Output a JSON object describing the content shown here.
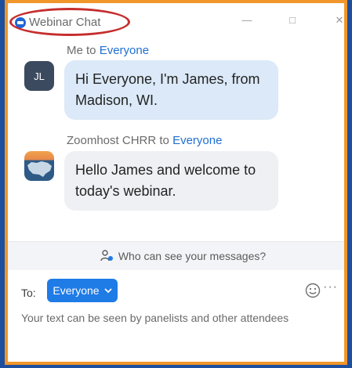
{
  "window": {
    "title": "Webinar Chat",
    "minimize_symbol": "—",
    "maximize_symbol": "□",
    "close_symbol": "✕"
  },
  "messages": [
    {
      "sender": "Me",
      "to_word": "to",
      "recipient": "Everyone",
      "avatar_initials": "JL",
      "text": "Hi Everyone, I'm James, from Madison, WI."
    },
    {
      "sender": "Zoomhost CHRR",
      "to_word": "to",
      "recipient": "Everyone",
      "avatar_icon": "map-logo-icon",
      "text": "Hello James and welcome to today's webinar."
    }
  ],
  "privacy": {
    "label": "Who can see your messages?"
  },
  "compose": {
    "to_label": "To:",
    "recipient_button": "Everyone",
    "placeholder": "Your text can be seen by panelists and other attendees",
    "more_symbol": "···"
  },
  "colors": {
    "accent": "#1f7be6",
    "frame": "#f0962b",
    "highlight_oval": "#c62d2d",
    "background": "#1d4f9e"
  }
}
